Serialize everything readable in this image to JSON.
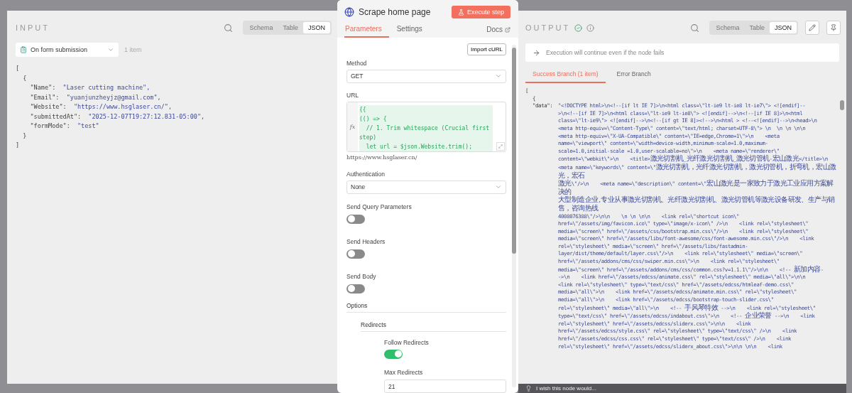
{
  "input": {
    "title": "INPUT",
    "views": [
      {
        "label": "Schema",
        "selected": false
      },
      {
        "label": "Table",
        "selected": false
      },
      {
        "label": "JSON",
        "selected": true
      }
    ],
    "source": "On form submission",
    "count": "1 item",
    "code": [
      "[",
      "  {",
      "    \"Name\":  \"Laser cutting machine\",",
      "    \"Email\":  \"yuanjunzheyjz@gmail.com\",",
      "    \"Website\":  \"https://www.hsglaser.cn/\",",
      "    \"submittedAt\":  \"2025-12-07T19:27:12.831-05:00\",",
      "    \"formMode\":  \"test\"",
      "  }",
      "]"
    ]
  },
  "node": {
    "title": "Scrape home page",
    "execute": "Execute step",
    "tabs": [
      {
        "label": "Parameters",
        "selected": true
      },
      {
        "label": "Settings",
        "selected": false
      }
    ],
    "docs": "Docs",
    "import_button": "Import cURL",
    "method": {
      "label": "Method",
      "value": "GET"
    },
    "url": {
      "label": "URL",
      "fx_label": "fx",
      "code": [
        "{{",
        "(() => {",
        "  // 1. Trim whitespace (Crucial first step)",
        "  let url = $json.Website.trim();"
      ],
      "preview": "https://www.hsglaser.cn/"
    },
    "authentication": {
      "label": "Authentication",
      "value": "None"
    },
    "toggles": [
      {
        "label": "Send Query Parameters",
        "on": false
      },
      {
        "label": "Send Headers",
        "on": false
      },
      {
        "label": "Send Body",
        "on": false
      }
    ],
    "options": {
      "label": "Options",
      "group": {
        "label": "Redirects",
        "follow": {
          "label": "Follow Redirects",
          "on": true
        },
        "max": {
          "label": "Max Redirects",
          "value": "21"
        }
      }
    }
  },
  "output": {
    "title": "OUTPUT",
    "views": [
      {
        "label": "Schema",
        "selected": false
      },
      {
        "label": "Table",
        "selected": false
      },
      {
        "label": "JSON",
        "selected": true
      }
    ],
    "notice": "Execution will continue even if the node fails",
    "branches": [
      {
        "label": "Success Branch (1 item)",
        "selected": true
      },
      {
        "label": "Error Branch",
        "selected": false
      }
    ],
    "open": [
      "[",
      "{"
    ],
    "key": "\"data\":",
    "lines": [
      "\"<!DOCTYPE html>\\n<!--[if lt IE 7]>\\n<html class=\\\"lt-ie9 lt-ie8 lt-ie7\\\"> <![endif]--",
      ">\\n<!--[if IE 7]>\\n<html class=\\\"lt-ie9 lt-ie8\\\"> <![endif]-->\\n<!--[if IE 8]>\\n<html",
      "class=\\\"lt-ie9\\\"> <![endif]-->\\n<!--[if gt IE 8]><!-->\\n<html > <!--<![endif]-->\\n<head>\\n",
      "<meta http-equiv=\\\"Content-Type\\\" content=\\\"text/html; charset=UTF-8\\\"> \\n  \\n \\n \\n\\n",
      "<meta http-equiv=\\\"X-UA-Compatible\\\" content=\\\"IE=edge,Chrome=1\\\">\\n    <meta",
      "name=\\\"viewport\\\" content=\\\"width=device-width,minimum-scale=1.0,maximum-",
      "scale=1.0,initial-scale =1.0,user-scalable=no\\\">\\n    <meta name=\\\"renderer\\\"",
      "content=\\\"webkit\\\">\\n    <title>激光切割机_光纤激光切割机_激光切管机-宏山激光</title>\\n",
      "<meta name=\\\"keywords\\\" content=\\\"激光切割机，光纤激光切割机，激光切管机，折弯机，宏山激光，宏石",
      "激光\\\"/>\\n    <meta name=\\\"description\\\" content=\\\"宏山激光是一家致力于激光工业应用方案解决的",
      "大型制造企业,专业从事激光切割机、光纤激光切割机、激光切管机等激光设备研发、生产与销售，咨询热线",
      "4008076388\\\"/>\\n\\n    \\n \\n \\n\\n    <link rel=\\\"shortcut icon\\\"",
      "href=\\\"/assets/img/favicon.ico\\\" type=\\\"image/x-icon\\\" />\\n    <link rel=\\\"stylesheet\\\"",
      "media=\\\"screen\\\" href=\\\"/assets/css/bootstrap.min.css\\\"/>\\n    <link rel=\\\"stylesheet\\\"",
      "media=\\\"screen\\\" href=\\\"/assets/libs/font-awesome/css/font-awesome.min.css\\\"/>\\n    <link",
      "rel=\\\"stylesheet\\\" media=\\\"screen\\\" href=\\\"/assets/libs/fastadmin-",
      "layer/dist/theme/default/layer.css\\\"/>\\n    <link rel=\\\"stylesheet\\\" media=\\\"screen\\\"",
      "href=\\\"/assets/addons/cms/css/swiper.min.css\\\">\\n    <link rel=\\\"stylesheet\\\"",
      "media=\\\"screen\\\" href=\\\"/assets/addons/cms/css/common.css?v=1.1.1\\\"/>\\n\\n    <!-- 新加内容-",
      "->\\n    <link href=\\\"/assets/edcss/animate.css\\\" rel=\\\"stylesheet\\\" media=\\\"all\\\">\\n\\n",
      "<link rel=\\\"stylesheet\\\" type=\\\"text/css\\\" href=\\\"/assets/edcss/htmleaf-demo.css\\\"",
      "media=\\\"all\\\">\\n    <link href=\\\"/assets/edcss/animate.min.css\\\" rel=\\\"stylesheet\\\"",
      "media=\\\"all\\\">\\n    <link href=\\\"/assets/edcss/bootstrap-touch-slider.css\\\"",
      "rel=\\\"stylesheet\\\" media=\\\"all\\\">\\n    <!-- 手风琴特效 -->\\n    <link rel=\\\"stylesheet\\\"",
      "type=\\\"text/css\\\" href=\\\"/assets/edcss/indabout.css\\\">\\n    <!-- 企业荣誉 -->\\n    <link",
      "rel=\\\"stylesheet\\\" href=\\\"/assets/edcss/sliderx.css\\\">\\n\\n    <link",
      "href=\\\"/assets/edcss/style.css\\\" rel=\\\"stylesheet\\\" type=\\\"text/css\\\" />\\n    <link",
      "href=\\\"/assets/edcss/css.css\\\" rel=\\\"stylesheet\\\" type=\\\"text/css\\\" />\\n    <link",
      "rel=\\\"stylesheet\\\" href=\\\"/assets/edcss/sliderx_about.css\\\">\\n\\n \\n\\n    <link"
    ]
  },
  "feedback": {
    "placeholder": "I wish this node would..."
  }
}
